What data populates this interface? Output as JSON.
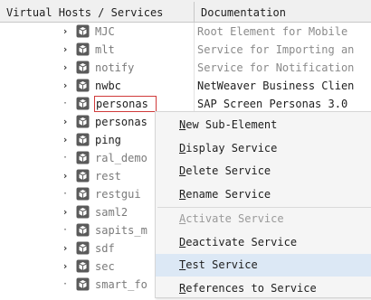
{
  "header": {
    "col1": "Virtual Hosts / Services",
    "col2": "Documentation"
  },
  "rows": [
    {
      "name": "MJC",
      "doc": "Root Element for Mobile",
      "expander": "›",
      "grey_name": true,
      "grey_doc": true
    },
    {
      "name": "mlt",
      "doc": "Service for Importing an",
      "expander": "›",
      "grey_name": true,
      "grey_doc": true
    },
    {
      "name": "notify",
      "doc": "Service for Notification",
      "expander": "›",
      "grey_name": true,
      "grey_doc": true
    },
    {
      "name": "nwbc",
      "doc": "NetWeaver Business Clien",
      "expander": "›",
      "grey_name": false,
      "grey_doc": false
    },
    {
      "name": "personas",
      "doc": "SAP Screen Personas 3.0",
      "expander": "·",
      "grey_name": false,
      "grey_doc": false,
      "selected": true
    },
    {
      "name": "personas",
      "doc": "",
      "expander": "›",
      "grey_name": false
    },
    {
      "name": "ping",
      "doc": "",
      "expander": "›",
      "grey_name": false
    },
    {
      "name": "ral_demo",
      "doc": "",
      "expander": "·",
      "grey_name": true
    },
    {
      "name": "rest",
      "doc": "",
      "expander": "›",
      "grey_name": true
    },
    {
      "name": "restgui",
      "doc": "",
      "expander": "·",
      "grey_name": true
    },
    {
      "name": "saml2",
      "doc": "",
      "expander": "›",
      "grey_name": true
    },
    {
      "name": "sapits_m",
      "doc": "",
      "expander": "·",
      "grey_name": true
    },
    {
      "name": "sdf",
      "doc": "",
      "expander": "›",
      "grey_name": true
    },
    {
      "name": "sec",
      "doc": "",
      "expander": "›",
      "grey_name": true
    },
    {
      "name": "smart_fo",
      "doc": "",
      "expander": "·",
      "grey_name": true
    }
  ],
  "context_menu": {
    "items": [
      {
        "label": "New Sub-Element",
        "underline": "N",
        "disabled": false,
        "highlighted": false
      },
      {
        "label": "Display Service",
        "underline": "D",
        "disabled": false,
        "highlighted": false
      },
      {
        "label": "Delete Service",
        "underline": "D",
        "disabled": false,
        "highlighted": false
      },
      {
        "label": "Rename Service",
        "underline": "R",
        "disabled": false,
        "highlighted": false
      },
      {
        "label": "Activate Service",
        "underline": "A",
        "disabled": true,
        "highlighted": false,
        "separator_before": true
      },
      {
        "label": "Deactivate Service",
        "underline": "D",
        "disabled": false,
        "highlighted": false
      },
      {
        "label": "Test Service",
        "underline": "T",
        "disabled": false,
        "highlighted": true
      },
      {
        "label": "References to Service",
        "underline": "R",
        "disabled": false,
        "highlighted": false
      }
    ]
  },
  "colors": {
    "highlight": "#dce8f5",
    "selection_border": "#d03a3a",
    "icon": "#555555"
  },
  "icons": {
    "node": "service-package-icon",
    "expander": "chevron-right-icon"
  }
}
